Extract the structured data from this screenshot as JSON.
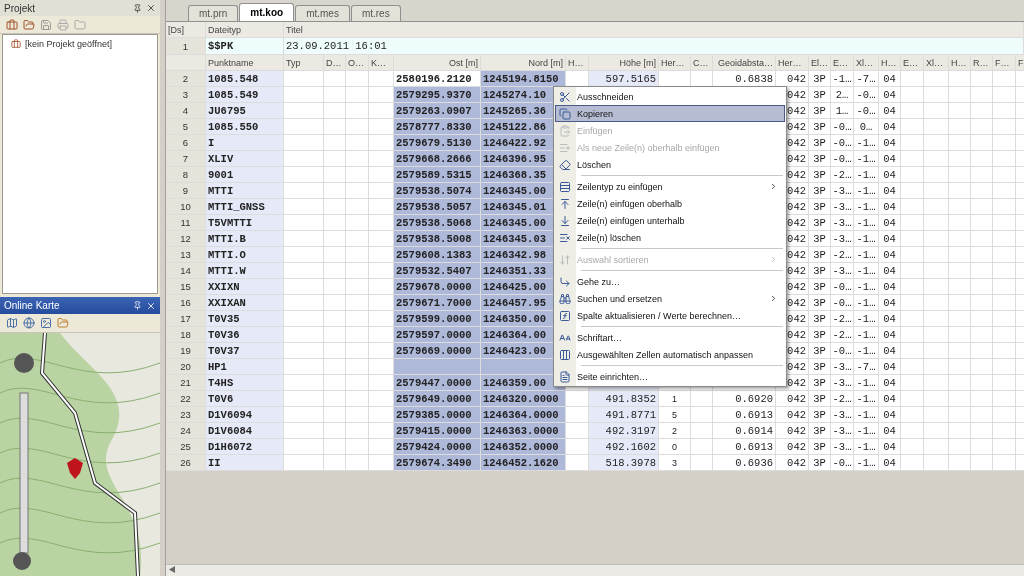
{
  "project_panel": {
    "title": "Projekt",
    "tree": [
      {
        "label": "[kein Projekt geöffnet]"
      }
    ]
  },
  "map_panel": {
    "title": "Online Karte"
  },
  "tabs": [
    {
      "label": "mt.prn",
      "selected": false
    },
    {
      "label": "mt.koo",
      "selected": true
    },
    {
      "label": "mt.mes",
      "selected": false
    },
    {
      "label": "mt.res",
      "selected": false
    }
  ],
  "file_header": {
    "corner": "[Ds]",
    "type_label": "Dateityp",
    "title_label": "Titel",
    "row_number": "1",
    "type": "$$PK",
    "title": "23.09.2011 16:01"
  },
  "table": {
    "columns": [
      {
        "label": "Punktname",
        "tinted": true,
        "selected": false
      },
      {
        "label": "Typ",
        "tinted": false,
        "selected": false
      },
      {
        "label": "D…",
        "tinted": false,
        "selected": false
      },
      {
        "label": "O…",
        "tinted": false,
        "selected": false
      },
      {
        "label": "K…",
        "tinted": false,
        "selected": false
      },
      {
        "label": "Ost [m]",
        "tinted": false,
        "selected": true
      },
      {
        "label": "Nord [m]",
        "tinted": false,
        "selected": true
      },
      {
        "label": "H…",
        "tinted": false,
        "selected": false
      },
      {
        "label": "Höhe [m]",
        "tinted": true,
        "selected": false
      },
      {
        "label": "Her…",
        "tinted": false,
        "selected": false
      },
      {
        "label": "C…",
        "tinted": false,
        "selected": false
      },
      {
        "label": "Geoidabsta…",
        "tinted": false,
        "selected": false
      },
      {
        "label": "Her…",
        "tinted": false,
        "selected": false
      },
      {
        "label": "El…",
        "tinted": false,
        "selected": false
      },
      {
        "label": "E…",
        "tinted": false,
        "selected": false
      },
      {
        "label": "Xl…",
        "tinted": false,
        "selected": false
      },
      {
        "label": "H…",
        "tinted": false,
        "selected": false
      },
      {
        "label": "E…",
        "tinted": false,
        "selected": false
      },
      {
        "label": "Xl…",
        "tinted": false,
        "selected": false
      },
      {
        "label": "H…",
        "tinted": false,
        "selected": false
      },
      {
        "label": "R…",
        "tinted": false,
        "selected": false
      },
      {
        "label": "F…",
        "tinted": false,
        "selected": false
      },
      {
        "label": "F",
        "tinted": false,
        "selected": false
      }
    ],
    "rows": [
      {
        "num": "2",
        "active": true,
        "cells": [
          "1085.548",
          null,
          null,
          null,
          null,
          "2580196.2120",
          "1245194.8150",
          null,
          "597.5165",
          null,
          null,
          "0.6838",
          "042",
          "3P",
          "-1…",
          "-7…",
          "04"
        ]
      },
      {
        "num": "3",
        "active": false,
        "cells": [
          "1085.549",
          null,
          null,
          null,
          null,
          "2579295.9370",
          "1245274.10",
          null,
          null,
          null,
          null,
          null,
          "042",
          "3P",
          "2…",
          "-0…",
          "04"
        ]
      },
      {
        "num": "4",
        "active": false,
        "cells": [
          "JU6795",
          null,
          null,
          null,
          null,
          "2579263.0907",
          "1245265.36",
          null,
          null,
          null,
          null,
          null,
          "042",
          "3P",
          "1…",
          "-0…",
          "04"
        ]
      },
      {
        "num": "5",
        "active": false,
        "cells": [
          "1085.550",
          null,
          null,
          null,
          null,
          "2578777.8330",
          "1245122.86",
          null,
          null,
          null,
          null,
          null,
          "042",
          "3P",
          "-0…",
          "0…",
          "04"
        ]
      },
      {
        "num": "6",
        "active": false,
        "cells": [
          "I",
          null,
          null,
          null,
          null,
          "2579679.5130",
          "1246422.92",
          null,
          null,
          null,
          null,
          null,
          "042",
          "3P",
          "-0…",
          "-1…",
          "04"
        ]
      },
      {
        "num": "7",
        "active": false,
        "cells": [
          "XLIV",
          null,
          null,
          null,
          null,
          "2579668.2666",
          "1246396.95",
          null,
          null,
          null,
          null,
          null,
          "042",
          "3P",
          "-0…",
          "-1…",
          "04"
        ]
      },
      {
        "num": "8",
        "active": false,
        "cells": [
          "9001",
          null,
          null,
          null,
          null,
          "2579589.5315",
          "1246368.35",
          null,
          null,
          null,
          null,
          null,
          "042",
          "3P",
          "-2…",
          "-1…",
          "04"
        ]
      },
      {
        "num": "9",
        "active": false,
        "cells": [
          "MTTI",
          null,
          null,
          null,
          null,
          "2579538.5074",
          "1246345.00",
          null,
          null,
          null,
          null,
          null,
          "042",
          "3P",
          "-3…",
          "-1…",
          "04"
        ]
      },
      {
        "num": "10",
        "active": false,
        "cells": [
          "MTTI_GNSS",
          null,
          null,
          null,
          null,
          "2579538.5057",
          "1246345.01",
          null,
          null,
          null,
          null,
          null,
          "042",
          "3P",
          "-3…",
          "-1…",
          "04"
        ]
      },
      {
        "num": "11",
        "active": false,
        "cells": [
          "T5VMTTI",
          null,
          null,
          null,
          null,
          "2579538.5068",
          "1246345.00",
          null,
          null,
          null,
          null,
          null,
          "042",
          "3P",
          "-3…",
          "-1…",
          "04"
        ]
      },
      {
        "num": "12",
        "active": false,
        "cells": [
          "MTTI.B",
          null,
          null,
          null,
          null,
          "2579538.5008",
          "1246345.03",
          null,
          null,
          null,
          null,
          null,
          "042",
          "3P",
          "-3…",
          "-1…",
          "04"
        ]
      },
      {
        "num": "13",
        "active": false,
        "cells": [
          "MTTI.O",
          null,
          null,
          null,
          null,
          "2579608.1383",
          "1246342.98",
          null,
          null,
          null,
          null,
          null,
          "042",
          "3P",
          "-2…",
          "-1…",
          "04"
        ]
      },
      {
        "num": "14",
        "active": false,
        "cells": [
          "MTTI.W",
          null,
          null,
          null,
          null,
          "2579532.5407",
          "1246351.33",
          null,
          null,
          null,
          null,
          null,
          "042",
          "3P",
          "-3…",
          "-1…",
          "04"
        ]
      },
      {
        "num": "15",
        "active": false,
        "cells": [
          "XXIXN",
          null,
          null,
          null,
          null,
          "2579678.0000",
          "1246425.00",
          null,
          null,
          null,
          null,
          null,
          "042",
          "3P",
          "-0…",
          "-1…",
          "04"
        ]
      },
      {
        "num": "16",
        "active": false,
        "cells": [
          "XXIXAN",
          null,
          null,
          null,
          null,
          "2579671.7000",
          "1246457.95",
          null,
          null,
          null,
          null,
          null,
          "042",
          "3P",
          "-0…",
          "-1…",
          "04"
        ]
      },
      {
        "num": "17",
        "active": false,
        "cells": [
          "T0V35",
          null,
          null,
          null,
          null,
          "2579599.0000",
          "1246350.00",
          null,
          null,
          null,
          null,
          null,
          "042",
          "3P",
          "-2…",
          "-1…",
          "04"
        ]
      },
      {
        "num": "18",
        "active": false,
        "cells": [
          "T0V36",
          null,
          null,
          null,
          null,
          "2579597.0000",
          "1246364.00",
          null,
          null,
          null,
          null,
          null,
          "042",
          "3P",
          "-2…",
          "-1…",
          "04"
        ]
      },
      {
        "num": "19",
        "active": false,
        "cells": [
          "T0V37",
          null,
          null,
          null,
          null,
          "2579669.0000",
          "1246423.00",
          null,
          null,
          null,
          null,
          null,
          "042",
          "3P",
          "-0…",
          "-1…",
          "04"
        ]
      },
      {
        "num": "20",
        "active": false,
        "cells": [
          "HP1",
          null,
          null,
          null,
          null,
          null,
          null,
          null,
          null,
          null,
          null,
          null,
          "042",
          "3P",
          "-3…",
          "-7…",
          "04"
        ]
      },
      {
        "num": "21",
        "active": false,
        "cells": [
          "T4HS",
          null,
          null,
          null,
          null,
          "2579447.0000",
          "1246359.00",
          null,
          null,
          null,
          null,
          null,
          "042",
          "3P",
          "-3…",
          "-1…",
          "04"
        ]
      },
      {
        "num": "22",
        "active": false,
        "cells": [
          "T0V6",
          null,
          null,
          null,
          null,
          "2579649.0000",
          "1246320.0000",
          null,
          "491.8352",
          "1",
          null,
          "0.6920",
          "042",
          "3P",
          "-2…",
          "-1…",
          "04"
        ]
      },
      {
        "num": "23",
        "active": false,
        "cells": [
          "D1V6094",
          null,
          null,
          null,
          null,
          "2579385.0000",
          "1246364.0000",
          null,
          "491.8771",
          "5",
          null,
          "0.6913",
          "042",
          "3P",
          "-3…",
          "-1…",
          "04"
        ]
      },
      {
        "num": "24",
        "active": false,
        "cells": [
          "D1V6084",
          null,
          null,
          null,
          null,
          "2579415.0000",
          "1246363.0000",
          null,
          "492.3197",
          "2",
          null,
          "0.6914",
          "042",
          "3P",
          "-3…",
          "-1…",
          "04"
        ]
      },
      {
        "num": "25",
        "active": false,
        "cells": [
          "D1H6072",
          null,
          null,
          null,
          null,
          "2579424.0000",
          "1246352.0000",
          null,
          "492.1602",
          "0",
          null,
          "0.6913",
          "042",
          "3P",
          "-3…",
          "-1…",
          "04"
        ]
      },
      {
        "num": "26",
        "active": false,
        "cells": [
          "II",
          null,
          null,
          null,
          null,
          "2579674.3490",
          "1246452.1620",
          null,
          "518.3978",
          "3",
          null,
          "0.6936",
          "042",
          "3P",
          "-0…",
          "-1…",
          "04"
        ]
      }
    ]
  },
  "context_menu": {
    "items": [
      {
        "kind": "item",
        "label": "Ausschneiden",
        "disabled": false,
        "selected": false,
        "submenu": false
      },
      {
        "kind": "item",
        "label": "Kopieren",
        "disabled": false,
        "selected": true,
        "submenu": false
      },
      {
        "kind": "item",
        "label": "Einfügen",
        "disabled": true,
        "selected": false,
        "submenu": false
      },
      {
        "kind": "item",
        "label": "Als neue Zeile(n) oberhalb einfügen",
        "disabled": true,
        "selected": false,
        "submenu": false
      },
      {
        "kind": "item",
        "label": "Löschen",
        "disabled": false,
        "selected": false,
        "submenu": false
      },
      {
        "kind": "separator"
      },
      {
        "kind": "item",
        "label": "Zeilentyp zu einfügen",
        "disabled": false,
        "selected": false,
        "submenu": true
      },
      {
        "kind": "item",
        "label": "Zeile(n) einfügen oberhalb",
        "disabled": false,
        "selected": false,
        "submenu": false
      },
      {
        "kind": "item",
        "label": "Zeile(n) einfügen unterhalb",
        "disabled": false,
        "selected": false,
        "submenu": false
      },
      {
        "kind": "item",
        "label": "Zeile(n) löschen",
        "disabled": false,
        "selected": false,
        "submenu": false
      },
      {
        "kind": "separator"
      },
      {
        "kind": "item",
        "label": "Auswahl sortieren",
        "disabled": true,
        "selected": false,
        "submenu": true
      },
      {
        "kind": "separator"
      },
      {
        "kind": "item",
        "label": "Gehe zu…",
        "disabled": false,
        "selected": false,
        "submenu": false
      },
      {
        "kind": "item",
        "label": "Suchen und ersetzen",
        "disabled": false,
        "selected": false,
        "submenu": true
      },
      {
        "kind": "item",
        "label": "Spalte aktualisieren / Werte berechnen…",
        "disabled": false,
        "selected": false,
        "submenu": false
      },
      {
        "kind": "separator"
      },
      {
        "kind": "item",
        "label": "Schriftart…",
        "disabled": false,
        "selected": false,
        "submenu": false
      },
      {
        "kind": "item",
        "label": "Ausgewählten Zellen automatisch anpassen",
        "disabled": false,
        "selected": false,
        "submenu": false
      },
      {
        "kind": "separator"
      },
      {
        "kind": "item",
        "label": "Seite einrichten…",
        "disabled": false,
        "selected": false,
        "submenu": false
      }
    ]
  }
}
